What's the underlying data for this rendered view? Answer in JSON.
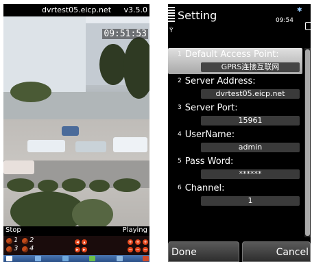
{
  "left_phone": {
    "title": "dvrtest05.eicp.net",
    "version": "v3.5.0",
    "timestamp": "09:51:53",
    "status_left": "Stop",
    "status_right": "Playing",
    "channels": [
      "1",
      "2",
      "3",
      "4"
    ]
  },
  "right_phone": {
    "title": "Setting",
    "time": "09:54",
    "items": [
      {
        "num": "1",
        "label": "Default Access Point:",
        "value": "GPRS连接互联网",
        "selected": true
      },
      {
        "num": "2",
        "label": "Server Address:",
        "value": "dvrtest05.eicp.net"
      },
      {
        "num": "3",
        "label": "Server Port:",
        "value": "15961"
      },
      {
        "num": "4",
        "label": "UserName:",
        "value": "admin"
      },
      {
        "num": "5",
        "label": "Pass Word:",
        "value": "******"
      },
      {
        "num": "6",
        "label": "Channel:",
        "value": "1"
      }
    ],
    "softkeys": {
      "left": "Done",
      "right": "Cancel"
    }
  },
  "colors": {
    "accent": "#e2451a",
    "toolbar": "#3b63a0",
    "selection": "#c8c8c8"
  }
}
